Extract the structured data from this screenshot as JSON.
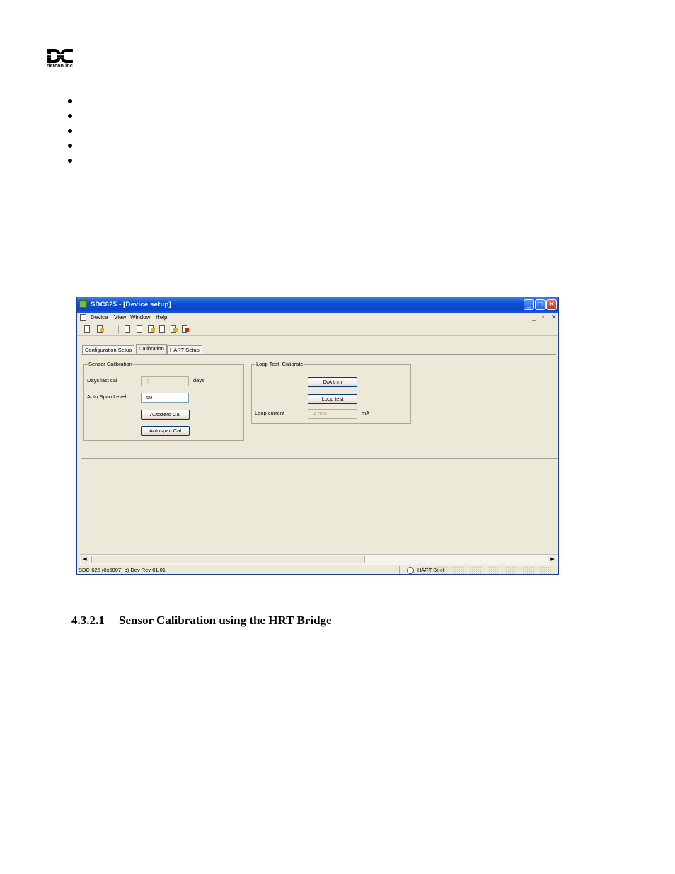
{
  "header": {
    "logo_letters": "DC",
    "logo_text": "detcon inc."
  },
  "bullets_count": 5,
  "window": {
    "title": "SDC625 - [Device setup]",
    "menu": [
      "Device",
      "View",
      "Window",
      "Help"
    ],
    "mdi_controls": [
      "_",
      "ɑ",
      "X"
    ],
    "tabs": [
      {
        "label": "Configuration Setup",
        "active": false
      },
      {
        "label": "Calibration",
        "active": true
      },
      {
        "label": "HART Setup",
        "active": false
      }
    ],
    "sensor_calibration": {
      "title": "Sensor Calibration",
      "days_last_cal_label": "Days last cal",
      "days_last_cal_value": "7",
      "days_unit": "days",
      "auto_span_label": "Auto Span Level",
      "auto_span_value": "50",
      "autozero_button": "Autozero Cal",
      "autospan_button": "Autospan Cal"
    },
    "loop_test": {
      "title": "Loop Test_Calibrate",
      "da_trim_button": "D/A trim",
      "loop_test_button": "Loop test",
      "loop_current_label": "Loop current",
      "loop_current_value": "4.000",
      "loop_current_unit": "mA"
    },
    "statusbar": {
      "device_info": "SDC-625   (0x6007) b) Dev Rev 01.01",
      "hart_status": "HART Beat"
    }
  },
  "section_heading": {
    "number": "4.3.2.1",
    "title": "Sensor Calibration using the HRT Bridge"
  }
}
